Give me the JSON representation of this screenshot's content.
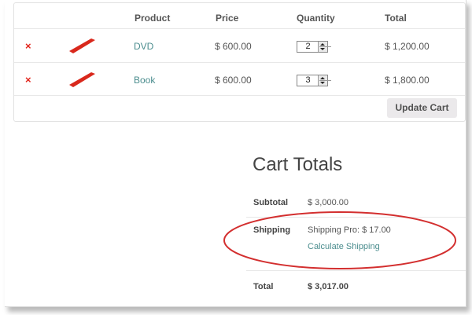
{
  "cart": {
    "headers": {
      "product": "Product",
      "price": "Price",
      "quantity": "Quantity",
      "total": "Total"
    },
    "items": [
      {
        "remove": "×",
        "name": "DVD",
        "price": "$ 600.00",
        "quantity": "2",
        "total": "$ 1,200.00"
      },
      {
        "remove": "×",
        "name": "Book",
        "price": "$ 600.00",
        "quantity": "3",
        "total": "$ 1,800.00"
      }
    ],
    "update_label": "Update Cart"
  },
  "totals": {
    "title": "Cart Totals",
    "subtotal_label": "Subtotal",
    "subtotal_value": "$ 3,000.00",
    "shipping_label": "Shipping",
    "shipping_value": "Shipping Pro: $ 17.00",
    "calculate_label": "Calculate Shipping",
    "total_label": "Total",
    "total_value": "$ 3,017.00"
  },
  "colors": {
    "remove": "#e2231a",
    "link": "#4b8d8e",
    "highlight": "#d32f2f",
    "thumb": "#d9281c"
  },
  "icons": {
    "remove": "close-icon",
    "thumbnail": "product-thumbnail-icon",
    "spinner": "quantity-spinner-icon"
  }
}
